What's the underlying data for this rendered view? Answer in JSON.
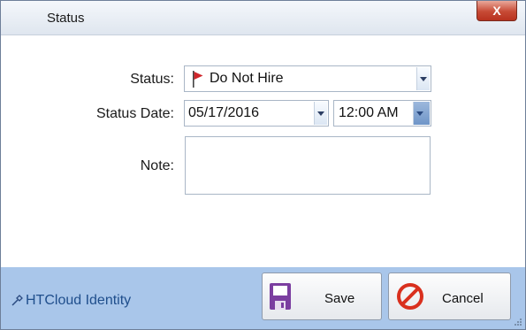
{
  "window": {
    "title": "Status",
    "close_label": "X"
  },
  "form": {
    "status_label": "Status:",
    "status_value": "Do Not Hire",
    "date_label": "Status Date:",
    "date_value": "05/17/2016",
    "time_value": "12:00 AM",
    "note_label": "Note:",
    "note_value": ""
  },
  "footer": {
    "identity": "HTCloud Identity",
    "save_label": "Save",
    "cancel_label": "Cancel"
  },
  "colors": {
    "footer_bg": "#a9c6ea",
    "flag": "#d0262b",
    "cancel_icon": "#d9301e",
    "save_icon": "#7b3ea0"
  }
}
